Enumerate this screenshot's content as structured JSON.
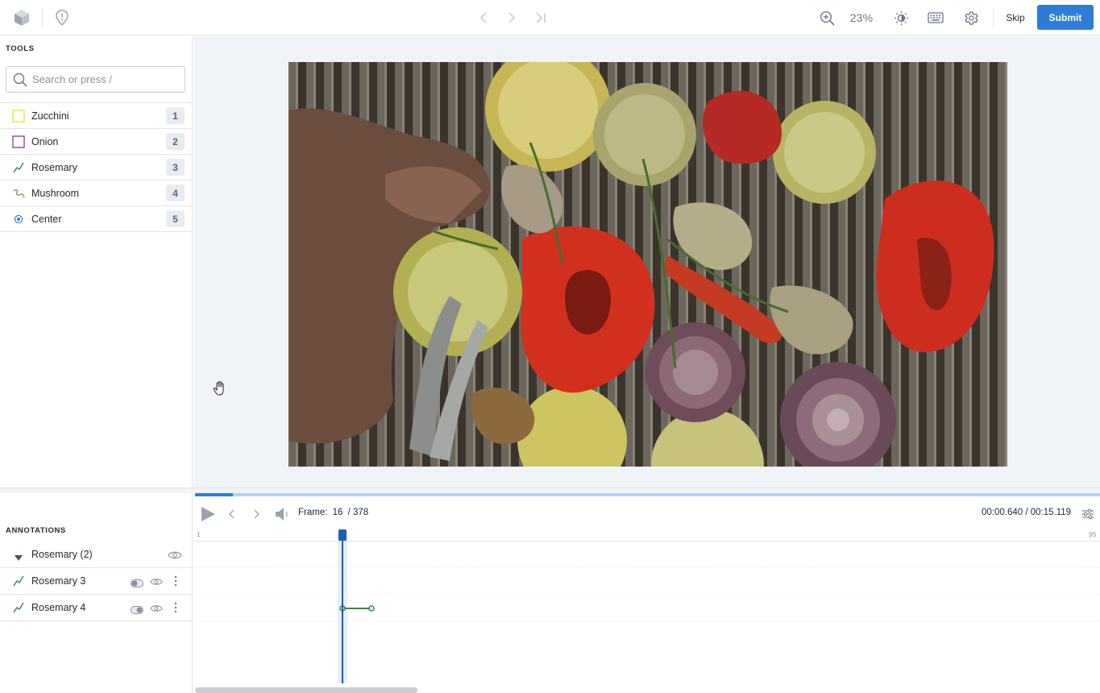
{
  "topbar": {
    "zoom": "23%",
    "skip_label": "Skip",
    "submit_label": "Submit"
  },
  "tools": {
    "section_label": "TOOLS",
    "search_placeholder": "Search or press /",
    "items": [
      {
        "name": "Zucchini",
        "hotkey": "1",
        "icon": "bbox-icon",
        "color": "#f2e35b"
      },
      {
        "name": "Onion",
        "hotkey": "2",
        "icon": "bbox-icon",
        "color": "#9b59b6"
      },
      {
        "name": "Rosemary",
        "hotkey": "3",
        "icon": "polyline-icon",
        "color": "#2e8b3a"
      },
      {
        "name": "Mushroom",
        "hotkey": "4",
        "icon": "freehand-icon",
        "color": "#a0855b"
      },
      {
        "name": "Center",
        "hotkey": "5",
        "icon": "point-icon",
        "color": "#2f7bd8"
      }
    ]
  },
  "annotations": {
    "section_label": "ANNOTATIONS",
    "group": {
      "name": "Rosemary (2)"
    },
    "items": [
      {
        "name": "Rosemary 3"
      },
      {
        "name": "Rosemary 4"
      }
    ]
  },
  "player": {
    "frame_label": "Frame:",
    "frame_current": "16",
    "frame_total": "/ 378",
    "time": "00:00.640 / 00:15.119",
    "progress": 0.042,
    "ruler_start": "1",
    "ruler_end": "95"
  },
  "colors": {
    "accent": "#2f7bd8",
    "rosemary_track": "#2e8b3a"
  }
}
